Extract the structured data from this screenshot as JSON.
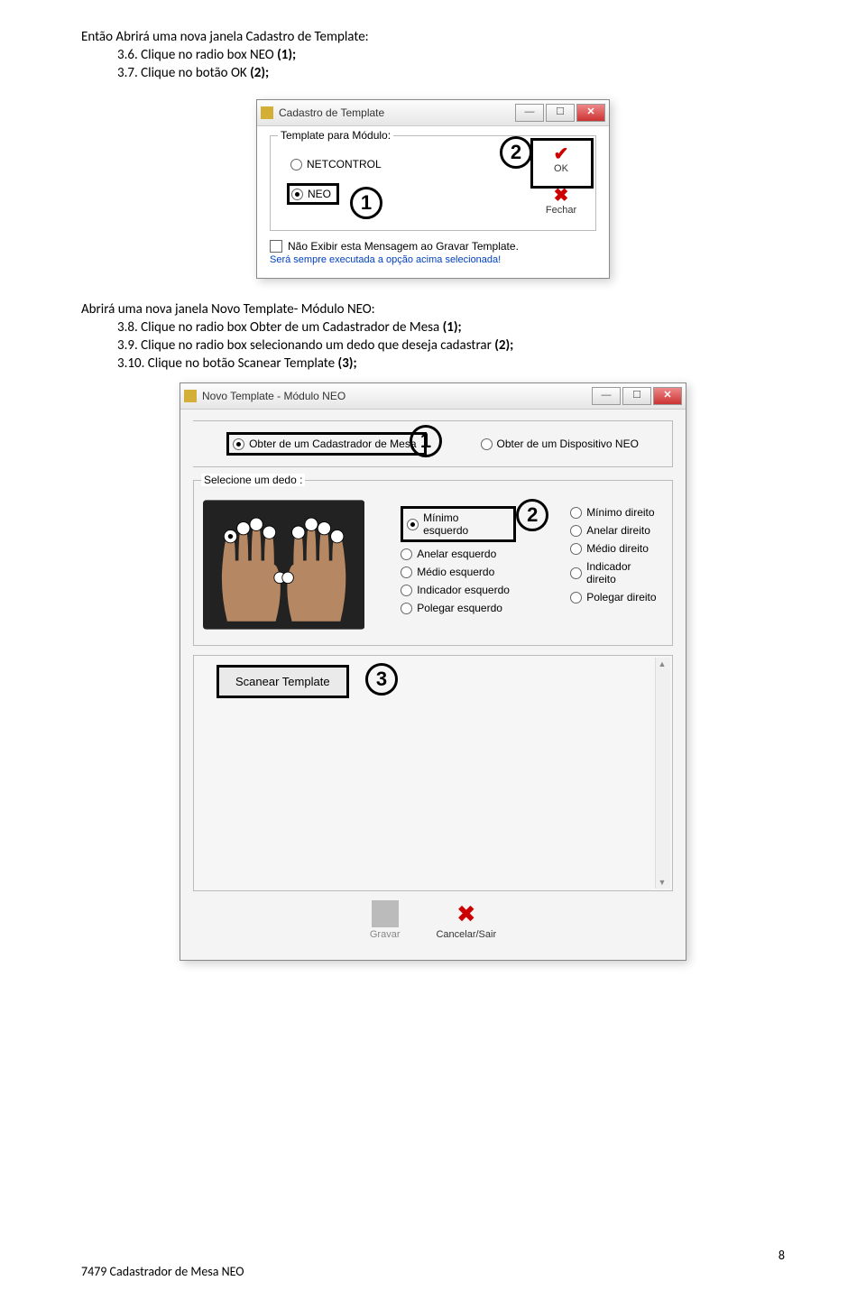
{
  "doc": {
    "line1": "Então Abrirá uma nova janela Cadastro de Template:",
    "step36_pre": "3.6.  Clique no radio box NEO ",
    "step36_bold": "(1);",
    "step37_pre": "3.7.  Clique no botão OK ",
    "step37_bold": "(2);",
    "line2": "Abrirá uma nova janela Novo Template- Módulo NEO:",
    "step38_pre": "3.8.  Clique no radio box Obter de um Cadastrador de Mesa ",
    "step38_bold": "(1);",
    "step39_pre": "3.9.  Clique no radio box selecionando um dedo que deseja cadastrar ",
    "step39_bold": "(2);",
    "step310_pre": "3.10. Clique no botão Scanear Template ",
    "step310_bold": "(3);",
    "footer": "7479 Cadastrador de Mesa NEO",
    "page_number": "8"
  },
  "dialog1": {
    "title": "Cadastro de Template",
    "group_label": "Template para Módulo:",
    "radio_netcontrol": "NETCONTROL",
    "radio_neo": "NEO",
    "btn_ok": "OK",
    "btn_fechar": "Fechar",
    "checkbox_label": "Não Exibir esta Mensagem ao Gravar Template.",
    "info_text": "Será sempre executada a opção acima selecionada!",
    "ann1": "1",
    "ann2": "2"
  },
  "dialog2": {
    "title": "Novo Template - Módulo NEO",
    "radio_obter_mesa": "Obter de um Cadastrador de Mesa",
    "radio_obter_neo": "Obter de um Dispositivo NEO",
    "group_finger": "Selecione um dedo :",
    "left": {
      "minimo": "Mínimo esquerdo",
      "anelar": "Anelar esquerdo",
      "medio": "Médio esquerdo",
      "indicador": "Indicador esquerdo",
      "polegar": "Polegar esquerdo"
    },
    "right": {
      "minimo": "Mínimo direito",
      "anelar": "Anelar direito",
      "medio": "Médio direito",
      "indicador": "Indicador direito",
      "polegar": "Polegar direito"
    },
    "btn_scan": "Scanear Template",
    "btn_gravar": "Gravar",
    "btn_cancelar": "Cancelar/Sair",
    "ann1": "1",
    "ann2": "2",
    "ann3": "3"
  }
}
